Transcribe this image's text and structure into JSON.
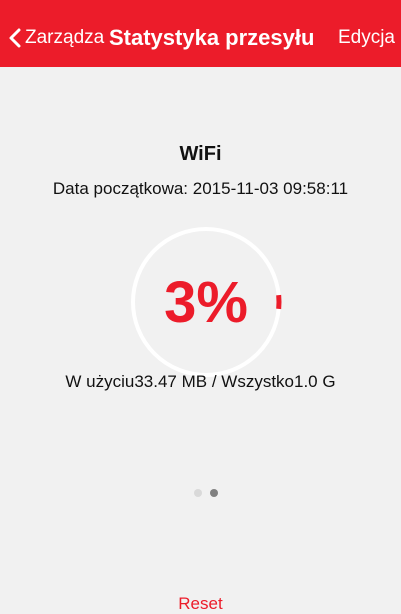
{
  "colors": {
    "accent": "#ec1c2a",
    "background": "#f1f1f1",
    "ring_track": "#ffffff"
  },
  "header": {
    "back_icon": "chevron-left-icon",
    "back_label": "Zarządza",
    "title": "Statystyka przesyłu",
    "edit_label": "Edycja"
  },
  "stats": {
    "network": "WiFi",
    "start_date": "Data początkowa: 2015-11-03 09:58:11",
    "percent_label": "3%",
    "percent_value": 3,
    "usage_text": "W użyciu33.47 MB / Wszystko1.0 G"
  },
  "pager": {
    "total_pages": 2,
    "active_page": 2
  },
  "footer": {
    "reset_label": "Reset"
  }
}
